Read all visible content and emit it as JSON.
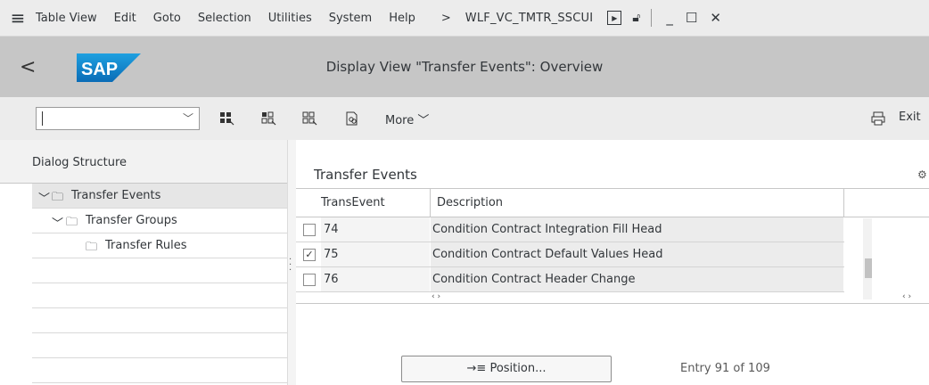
{
  "menubar": {
    "items": [
      "Table View",
      "Edit",
      "Goto",
      "Selection",
      "Utilities",
      "System",
      "Help"
    ],
    "chevron": ">",
    "tcode": "WLF_VC_TMTR_SSCUI"
  },
  "header": {
    "back": "<",
    "logo": "SAP",
    "title": "Display View \"Transfer Events\": Overview"
  },
  "toolbar": {
    "command_value": "",
    "more_label": "More",
    "exit_label": "Exit"
  },
  "dialog": {
    "title": "Dialog Structure",
    "nodes": [
      {
        "label": "Transfer Events"
      },
      {
        "label": "Transfer Groups"
      },
      {
        "label": "Transfer Rules"
      }
    ]
  },
  "table": {
    "title": "Transfer Events",
    "columns": [
      "TransEvent",
      "Description"
    ],
    "rows": [
      {
        "event": "74",
        "description": "Condition Contract Integration Fill Head",
        "checked": false
      },
      {
        "event": "75",
        "description": "Condition Contract Default Values Head",
        "checked": true
      },
      {
        "event": "76",
        "description": "Condition Contract Header Change",
        "checked": false
      }
    ]
  },
  "footer": {
    "position_label": "Position...",
    "entry_text": "Entry 91 of 109"
  }
}
